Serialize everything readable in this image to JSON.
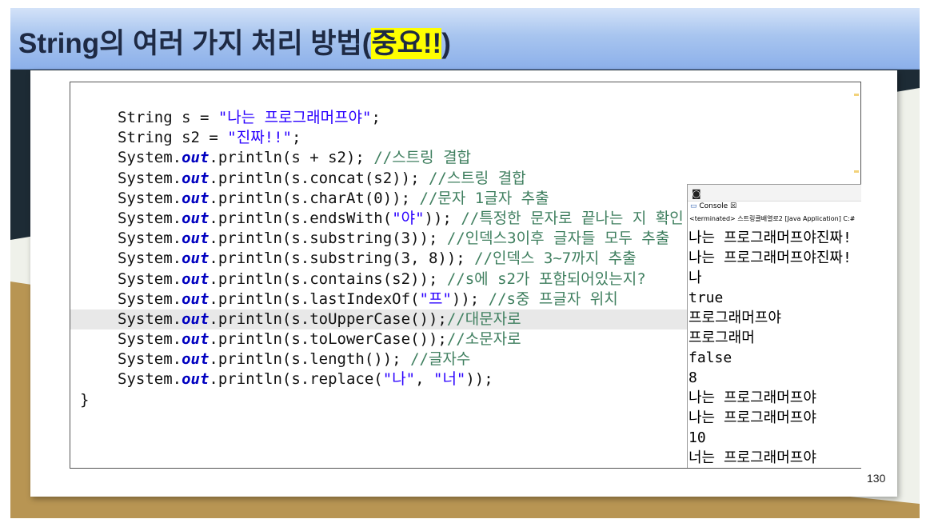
{
  "slide": {
    "title_main": "String의 여러 가지 처리 방법(",
    "title_highlight": "중요!!",
    "title_end": ")",
    "page_number": "130"
  },
  "code": {
    "line1": {
      "a": "String s = ",
      "b": "\"나는 프로그래머프야\"",
      "c": ";"
    },
    "line2": {
      "a": "String s2 = ",
      "b": "\"진짜!!\"",
      "c": ";"
    },
    "line3": {
      "a": "System.",
      "kw": "out",
      "b": ".println(s + s2); ",
      "cmt": "//스트링 결합"
    },
    "line4": {
      "a": "System.",
      "kw": "out",
      "b": ".println(s.concat(s2)); ",
      "cmt": "//스트링 결합"
    },
    "line5": {
      "a": "System.",
      "kw": "out",
      "b": ".println(s.charAt(0)); ",
      "cmt": "//문자 1글자 추출"
    },
    "line6": {
      "a": "System.",
      "kw": "out",
      "b": ".println(s.endsWith(",
      "str": "\"야\"",
      "c": ")); ",
      "cmt": "//특정한 문자로 끝나는 지 확인"
    },
    "line7": {
      "a": "System.",
      "kw": "out",
      "b": ".println(s.substring(3)); ",
      "cmt": "//인덱스3이후 글자들 모두 추출"
    },
    "line8": {
      "a": "System.",
      "kw": "out",
      "b": ".println(s.substring(3, 8)); ",
      "cmt": "//인덱스 3~7까지 추출"
    },
    "line9": {
      "a": "System.",
      "kw": "out",
      "b": ".println(s.contains(s2)); ",
      "cmt": "//s에 s2가 포함되어있는지?"
    },
    "line10": {
      "a": "System.",
      "kw": "out",
      "b": ".println(s.lastIndexOf(",
      "str": "\"프\"",
      "c": ")); ",
      "cmt": "//s중 프글자 위치"
    },
    "line11": {
      "a": "System.",
      "kw": "out",
      "b": ".println(s.toUpperCase());",
      "cmt": "//대문자로"
    },
    "line12": {
      "a": "System.",
      "kw": "out",
      "b": ".println(s.toLowerCase());",
      "cmt": "//소문자로"
    },
    "line13": {
      "a": "System.",
      "kw": "out",
      "b": ".println(s.length()); ",
      "cmt": "//글자수"
    },
    "line14": {
      "a": "System.",
      "kw": "out",
      "b": ".println(s.replace(",
      "str1": "\"나\"",
      "m": ", ",
      "str2": "\"너\"",
      "c": "));"
    },
    "line15": "}"
  },
  "console": {
    "tab_label": "Console",
    "tab_close": "☒",
    "status": "<terminated> 스트링클배열로2 [Java Application] C:#",
    "output": [
      "나는 프로그래머프야진짜!",
      "나는 프로그래머프야진짜!",
      "나",
      "true",
      "프로그래머프야",
      "프로그래머",
      "false",
      "8",
      "나는 프로그래머프야",
      "나는 프로그래머프야",
      "10",
      "너는 프로그래머프야"
    ]
  },
  "colors": {
    "title_bg": "#a8c5ef",
    "highlight": "#ffff00",
    "string": "#2a00ff",
    "keyword": "#0000c0",
    "comment": "#3f7f5f"
  }
}
